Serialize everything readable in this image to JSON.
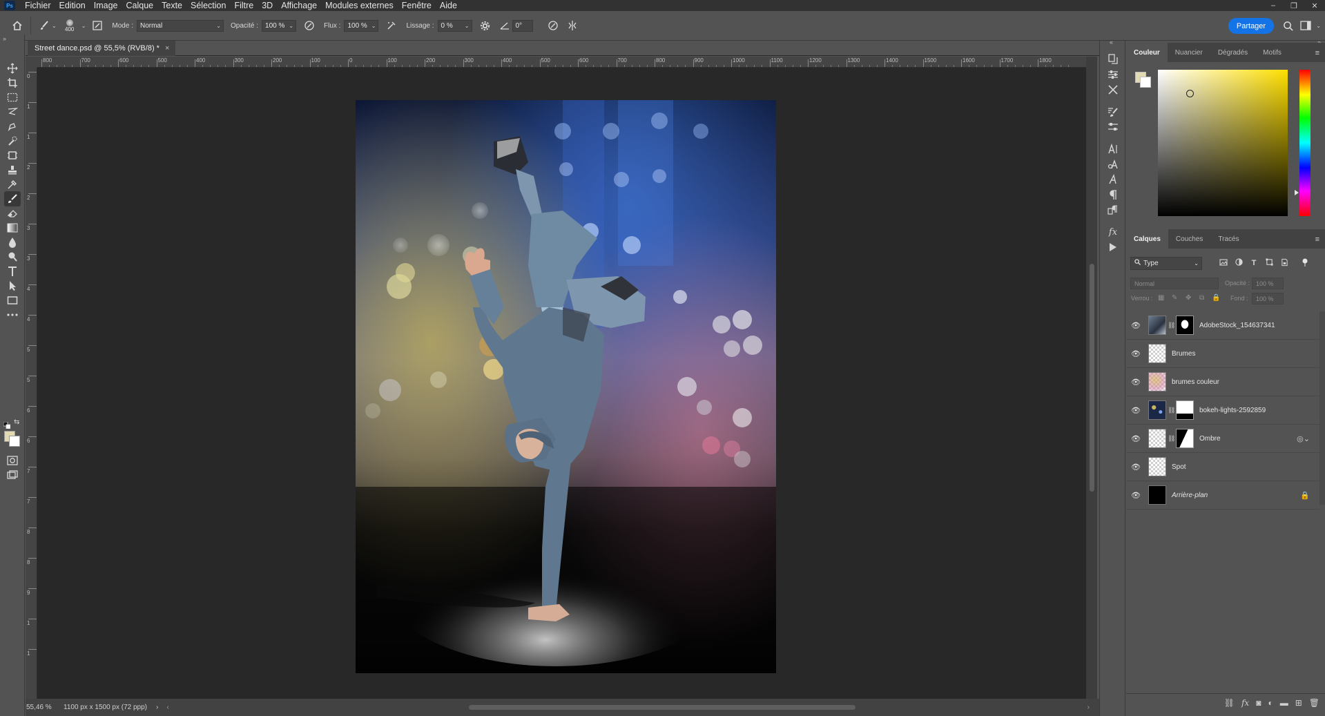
{
  "app": {
    "logo": "Ps",
    "menu": [
      "Fichier",
      "Edition",
      "Image",
      "Calque",
      "Texte",
      "Sélection",
      "Filtre",
      "3D",
      "Affichage",
      "Modules externes",
      "Fenêtre",
      "Aide"
    ]
  },
  "window_controls": {
    "minimize": "–",
    "restore": "❐",
    "close": "✕"
  },
  "options_bar": {
    "brush_size": "400",
    "mode_label": "Mode :",
    "mode_value": "Normal",
    "opacity_label": "Opacité :",
    "opacity_value": "100 %",
    "flow_label": "Flux :",
    "flow_value": "100 %",
    "smoothing_label": "Lissage :",
    "smoothing_value": "0 %",
    "angle_value": "0°",
    "share_label": "Partager"
  },
  "document": {
    "tab_title": "Street dance.psd @ 55,5% (RVB/8) *",
    "close_glyph": "×"
  },
  "ruler": {
    "top_ticks": [
      "800",
      "700",
      "600",
      "500",
      "400",
      "300",
      "200",
      "100",
      "0",
      "100",
      "200",
      "300",
      "400",
      "500",
      "600",
      "700",
      "800",
      "900",
      "1000",
      "1100",
      "1200",
      "1300",
      "1400",
      "1500",
      "1600",
      "1700",
      "1800"
    ],
    "left_ticks": [
      "0",
      "1",
      "1",
      "2",
      "2",
      "3",
      "3",
      "4",
      "4",
      "5",
      "5",
      "6",
      "6",
      "7",
      "7",
      "8",
      "8",
      "9",
      "1",
      "1"
    ]
  },
  "status": {
    "zoom": "55,46 %",
    "doc_info": "1100 px x 1500 px (72 ppp)",
    "arrow": "›"
  },
  "color_panel": {
    "tabs": [
      "Couleur",
      "Nuancier",
      "Dégradés",
      "Motifs"
    ],
    "active_tab": "Couleur",
    "foreground": "#e2dab0",
    "background": "#ffffff",
    "hue_base": "#ffdf00"
  },
  "layers_panel": {
    "tabs": [
      "Calques",
      "Couches",
      "Tracés"
    ],
    "active_tab": "Calques",
    "filter_label": "Type",
    "blend_mode": "Normal",
    "opacity_label": "Opacité :",
    "opacity_value": "100 %",
    "lock_label": "Verrou :",
    "fill_label": "Fond :",
    "fill_value": "100 %",
    "layers": [
      {
        "name": "AdobeStock_154637341",
        "has_mask": true,
        "thumb": "dancer",
        "mask": "silhouette"
      },
      {
        "name": "Brumes",
        "has_mask": false,
        "thumb": "checker"
      },
      {
        "name": "brumes couleur",
        "has_mask": false,
        "thumb": "color-checker"
      },
      {
        "name": "bokeh-lights-2592859",
        "has_mask": true,
        "thumb": "bokeh",
        "mask": "white-black"
      },
      {
        "name": "Ombre",
        "has_mask": true,
        "thumb": "checker-shadow",
        "mask": "diagonal"
      },
      {
        "name": "Spot",
        "has_mask": false,
        "thumb": "checker"
      },
      {
        "name": "Arrière-plan",
        "has_mask": false,
        "thumb": "black",
        "italic": true,
        "locked": true
      }
    ]
  }
}
